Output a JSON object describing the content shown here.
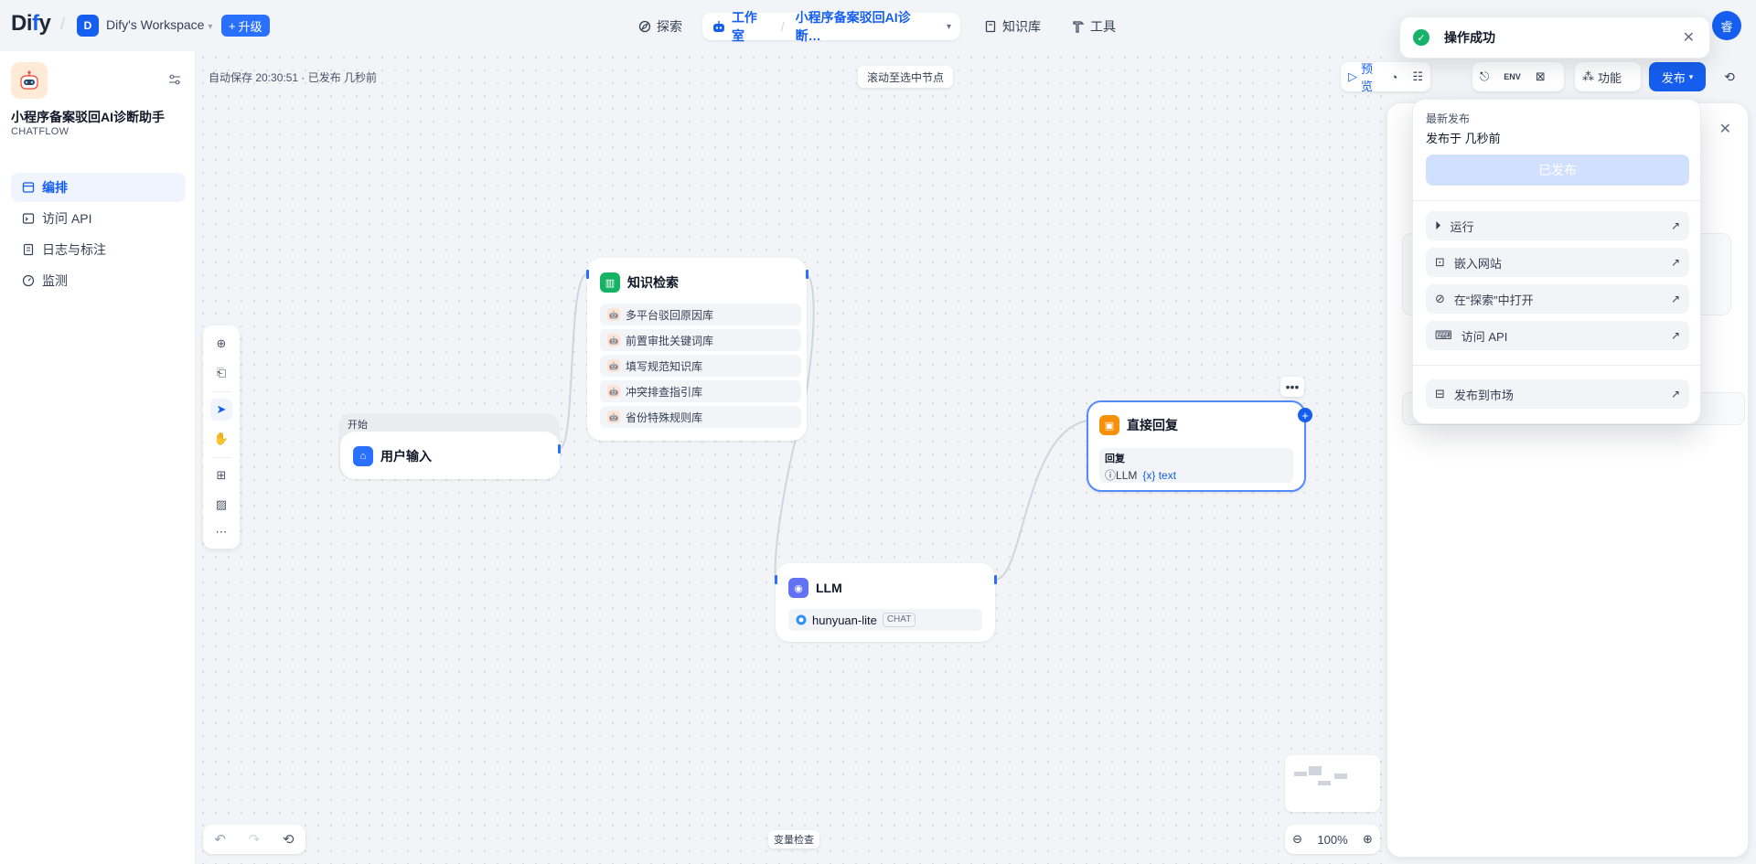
{
  "header": {
    "logo": "Dify",
    "workspace_initial": "D",
    "workspace_name": "Dify's Workspace",
    "upgrade_label": "升级",
    "nav": {
      "explore": "探索",
      "studio": "工作室",
      "current_app": "小程序备案驳回AI诊断…",
      "knowledge": "知识库",
      "tools": "工具"
    },
    "user_initial": "睿"
  },
  "toast": {
    "message": "操作成功"
  },
  "sidebar": {
    "app_name": "小程序备案驳回AI诊断助手",
    "app_type": "CHATFLOW",
    "items": [
      {
        "label": "编排",
        "active": true
      },
      {
        "label": "访问 API",
        "active": false
      },
      {
        "label": "日志与标注",
        "active": false
      },
      {
        "label": "监测",
        "active": false
      }
    ]
  },
  "canvas": {
    "autosave": "自动保存 20:30:51 · 已发布 几秒前",
    "scroll_to_selected": "滚动至选中节点",
    "variable_check": "变量检查",
    "zoom": "100%",
    "nodes": {
      "start": {
        "header": "开始",
        "title": "用户输入"
      },
      "knowledge": {
        "title": "知识检索",
        "datasets": [
          "多平台驳回原因库",
          "前置审批关键词库",
          "填写规范知识库",
          "冲突排查指引库",
          "省份特殊规则库"
        ]
      },
      "llm": {
        "title": "LLM",
        "model": "hunyuan-lite",
        "mode": "CHAT"
      },
      "answer": {
        "title": "直接回复",
        "field_label": "回复",
        "source": "LLM",
        "variable": "{x} text"
      }
    }
  },
  "toolbar": {
    "preview": "预览",
    "features": "功能",
    "publish": "发布"
  },
  "publish_menu": {
    "latest_label": "最新发布",
    "published_time": "发布于 几秒前",
    "published_button": "已发布",
    "items": [
      {
        "label": "运行",
        "icon": "play-icon"
      },
      {
        "label": "嵌入网站",
        "icon": "embed-icon"
      },
      {
        "label": "在“探索”中打开",
        "icon": "explore-icon"
      },
      {
        "label": "访问 API",
        "icon": "terminal-icon"
      },
      {
        "label": "发布到市场",
        "icon": "marketplace-icon"
      }
    ]
  },
  "colors": {
    "accent": "#155eef",
    "success": "#17b26a",
    "knowledge": "#16b364",
    "llm": "#6172f3",
    "answer": "#f79009"
  }
}
